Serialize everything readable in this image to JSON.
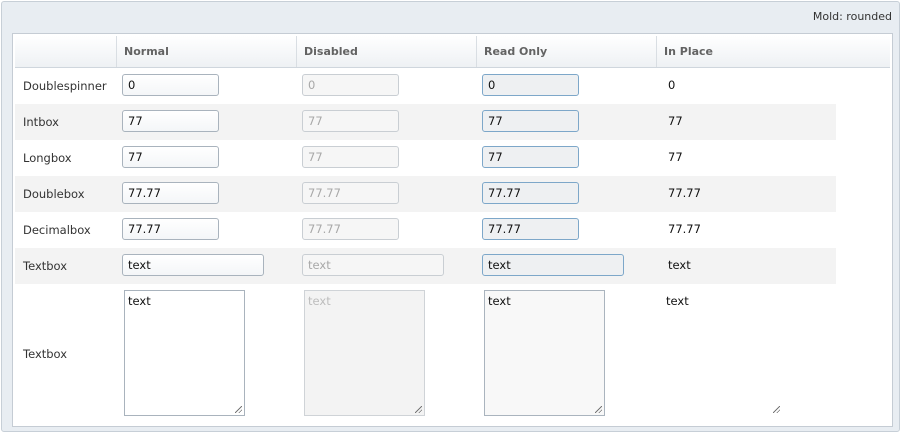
{
  "window": {
    "mold_label": "Mold: rounded"
  },
  "columns": [
    "",
    "Normal",
    "Disabled",
    "Read Only",
    "In Place"
  ],
  "rows": [
    {
      "label": "Doublespinner",
      "value": "0"
    },
    {
      "label": "Intbox",
      "value": "77"
    },
    {
      "label": "Longbox",
      "value": "77"
    },
    {
      "label": "Doublebox",
      "value": "77.77"
    },
    {
      "label": "Decimalbox",
      "value": "77.77"
    },
    {
      "label": "Textbox",
      "value": "text"
    },
    {
      "label": "Textbox",
      "value": "text"
    }
  ],
  "colors": {
    "readonly_border": "#7da7c9",
    "alt_row": "#f3f3f3",
    "frame_bg": "#e8edf2"
  },
  "icons": [
    "resize-grip-icon"
  ]
}
